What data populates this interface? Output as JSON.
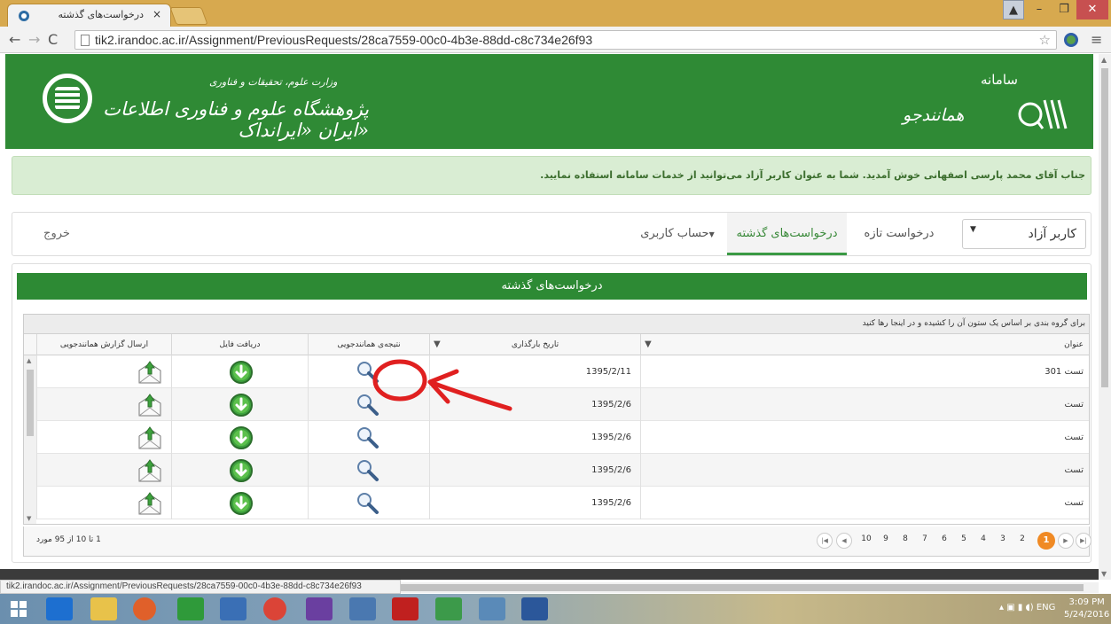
{
  "browser": {
    "tab_title": "درخواست‌های گذشته",
    "tab_close": "×",
    "url": "tik2.irandoc.ac.ir/Assignment/PreviousRequests/28ca7559-00c0-4b3e-88dd-c8c734e26f93",
    "status_url": "tik2.irandoc.ac.ir/Assignment/PreviousRequests/28ca7559-00c0-4b3e-88dd-c8c734e26f93"
  },
  "header": {
    "org_small": "وزارت علوم، تحقیقات و فناوری",
    "org_big": "پژوهشگاه علوم و فناوری اطلاعات ایران «ایرانداک»",
    "system_small": "سامانه",
    "system_big": "همانندجو"
  },
  "alert": {
    "text": "جناب آقای محمد پارسی اصفهانی خوش آمدید. شما به عنوان کاربر آزاد می‌توانید از خدمات سامانه استفاده نمایید."
  },
  "nav": {
    "user_type": "کاربر آزاد",
    "new_request": "درخواست تازه",
    "previous_requests": "درخواست‌های گذشته",
    "account": "حساب کاربری",
    "logout": "خروج"
  },
  "panel": {
    "title": "درخواست‌های گذشته"
  },
  "grid": {
    "group_hint": "برای گروه بندی بر اساس یک ستون آن را کشیده و در اینجا رها کنید",
    "columns": {
      "title": "عنوان",
      "upload_date": "تاریخ بارگذاری",
      "result": "نتیجه‌ی همانندجویی",
      "download": "دریافت فایل",
      "send_report": "ارسال گزارش همانندجویی"
    },
    "rows": [
      {
        "title": "تست 301",
        "date": "1395/2/11"
      },
      {
        "title": "تست",
        "date": "1395/2/6"
      },
      {
        "title": "تست",
        "date": "1395/2/6"
      },
      {
        "title": "تست",
        "date": "1395/2/6"
      },
      {
        "title": "تست",
        "date": "1395/2/6"
      }
    ],
    "pager": {
      "summary": "1 تا 10 از 95 مورد",
      "pages": [
        "10",
        "9",
        "8",
        "7",
        "6",
        "5",
        "4",
        "3",
        "2"
      ],
      "current": "1"
    }
  },
  "taskbar": {
    "lang": "ENG",
    "time": "3:09 PM",
    "date": "5/24/2016"
  },
  "colors": {
    "brand_green": "#2f8a35",
    "pager_active": "#f08a24",
    "annotation_red": "#e02020"
  }
}
